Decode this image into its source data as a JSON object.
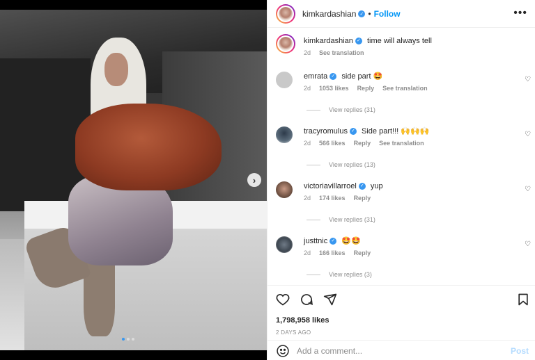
{
  "post": {
    "username": "kimkardashian",
    "follow_label": "Follow",
    "more_label": "•••",
    "caption": "time will always tell",
    "caption_age": "2d",
    "see_translation": "See translation",
    "carousel_next": "›",
    "carousel_count": 3,
    "carousel_index": 1
  },
  "comments": [
    {
      "username": "emrata",
      "text": "side part 🤩",
      "age": "2d",
      "likes": "1053 likes",
      "reply": "Reply",
      "translate": "See translation",
      "view_replies": "View replies (31)",
      "avatar_color": "#c9c9c9"
    },
    {
      "username": "tracyromulus",
      "text": "Side part!!! 🙌🙌🙌",
      "age": "2d",
      "likes": "566 likes",
      "reply": "Reply",
      "translate": "See translation",
      "view_replies": "View replies (13)",
      "avatar_color": "#5a6b7a"
    },
    {
      "username": "victoriavillarroel",
      "text": "yup",
      "age": "2d",
      "likes": "174 likes",
      "reply": "Reply",
      "translate": "",
      "view_replies": "View replies (31)",
      "avatar_color": "#7a5a4a"
    },
    {
      "username": "justtnic",
      "text": "🤩🤩",
      "age": "2d",
      "likes": "166 likes",
      "reply": "Reply",
      "translate": "",
      "view_replies": "View replies (3)",
      "avatar_color": "#3d4650"
    }
  ],
  "footer": {
    "likes": "1,798,958 likes",
    "time": "2 DAYS AGO",
    "comment_placeholder": "Add a comment...",
    "post_label": "Post"
  },
  "colors": {
    "link": "#0095f6",
    "verified": "#3897f0",
    "muted": "#8e8e8e"
  }
}
